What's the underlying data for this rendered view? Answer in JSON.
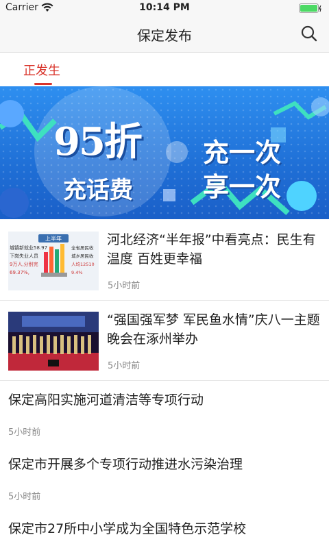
{
  "status_bar": {
    "carrier": "Carrier",
    "time": "10:14 PM",
    "battery_color": "#4cd964"
  },
  "navbar": {
    "title": "保定发布",
    "search_icon": "search-icon"
  },
  "tabs": [
    {
      "label": "正发生",
      "active": true,
      "color": "#d9342b"
    }
  ],
  "banner": {
    "big_text": "95折",
    "sub_text": "充话费",
    "line1": "充一次",
    "line2": "享一次"
  },
  "news": [
    {
      "headline": "河北经济“半年报”中看亮点：民生有温度 百姓更幸福",
      "time": "5小时前",
      "has_image": true,
      "image_text": [
        "上半年",
        "城镇新就业58.97",
        "下岗失业人员",
        "9万人,分别完",
        "69.37%,",
        "全省居民收",
        "城乡居民收",
        "人均12510",
        "9.4%"
      ]
    },
    {
      "headline": "“强国强军梦 军民鱼水情”庆八一主题晚会在涿州举办",
      "time": "5小时前",
      "has_image": true
    },
    {
      "headline": "保定高阳实施河道清洁等专项行动",
      "time": "5小时前",
      "has_image": false
    },
    {
      "headline": "保定市开展多个专项行动推进水污染治理",
      "time": "5小时前",
      "has_image": false
    },
    {
      "headline": "保定市27所中小学成为全国特色示范学校",
      "time": "",
      "has_image": false
    }
  ]
}
